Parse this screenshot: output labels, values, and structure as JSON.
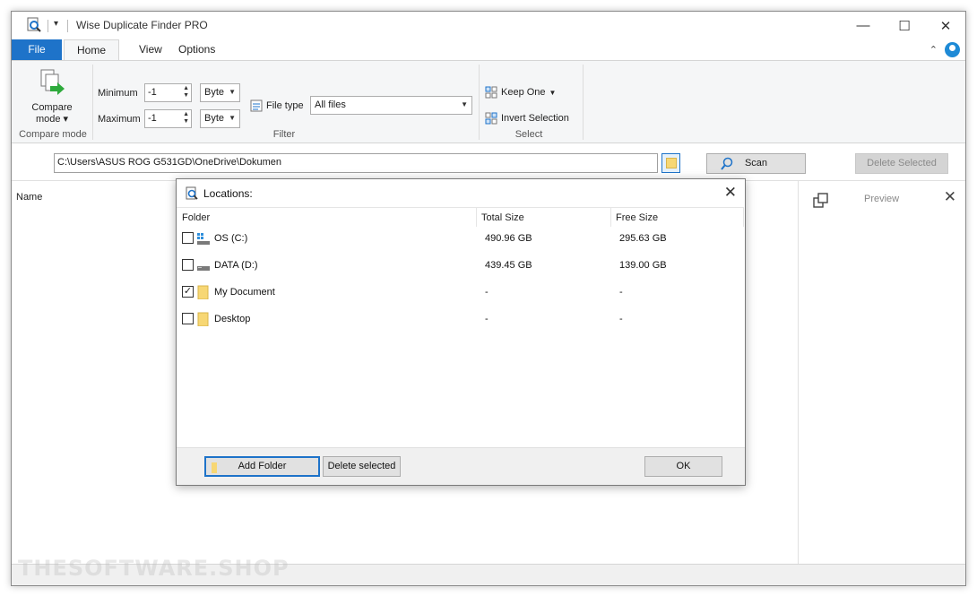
{
  "window": {
    "title": "Wise Duplicate Finder PRO",
    "qat_label": "▾"
  },
  "tabs": [
    {
      "label": "File"
    },
    {
      "label": "Home"
    },
    {
      "label": "View"
    },
    {
      "label": "Options"
    }
  ],
  "ribbon": {
    "compare_mode": {
      "label": "Compare mode ▾",
      "group": "Compare mode"
    },
    "filter": {
      "minimum_label": "Minimum",
      "minimum_value": "-1",
      "minimum_unit": "Byte",
      "maximum_label": "Maximum",
      "maximum_value": "-1",
      "maximum_unit": "Byte",
      "file_type_label": "File type",
      "file_type_value": "All files",
      "group": "Filter"
    },
    "select": {
      "keep_one": "Keep One",
      "invert_selection": "Invert Selection",
      "group": "Select"
    }
  },
  "pathbar": {
    "path": "C:\\Users\\ASUS ROG G531GD\\OneDrive\\Dokumen",
    "scan_label": "Scan",
    "delete_selected_label": "Delete Selected"
  },
  "results": {
    "column_name": "Name"
  },
  "preview": {
    "label": "Preview"
  },
  "watermark": "THESOFTWARE.SHOP",
  "dialog": {
    "title": "Locations:",
    "columns": {
      "folder": "Folder",
      "total": "Total Size",
      "free": "Free Size"
    },
    "rows": [
      {
        "name": "OS (C:)",
        "total": "490.96 GB",
        "free": "295.63 GB",
        "checked": false,
        "icon": "windows-drive-icon"
      },
      {
        "name": "DATA (D:)",
        "total": "439.45 GB",
        "free": "139.00 GB",
        "checked": false,
        "icon": "drive-icon"
      },
      {
        "name": "My Document",
        "total": "-",
        "free": "-",
        "checked": true,
        "icon": "folder-icon"
      },
      {
        "name": "Desktop",
        "total": "-",
        "free": "-",
        "checked": false,
        "icon": "folder-icon"
      }
    ],
    "add_folder_label": "Add Folder",
    "delete_selected_label": "Delete selected",
    "ok_label": "OK"
  },
  "colors": {
    "accent": "#1e73c9",
    "folder": "#f7d774"
  }
}
